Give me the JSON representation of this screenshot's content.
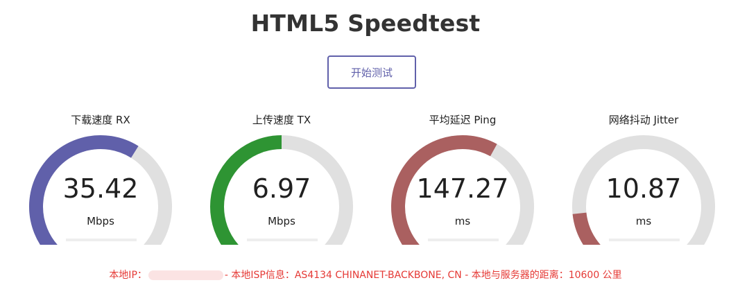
{
  "page": {
    "title": "HTML5 Speedtest",
    "start_button_label": "开始测试"
  },
  "gauges": [
    {
      "label": "下载速度 RX",
      "value": "35.42",
      "unit": "Mbps",
      "fill_fraction": 0.6,
      "color": "#6060AA"
    },
    {
      "label": "上传速度 TX",
      "value": "6.97",
      "unit": "Mbps",
      "fill_fraction": 0.5,
      "color": "#2E9433"
    },
    {
      "label": "平均延迟 Ping",
      "value": "147.27",
      "unit": "ms",
      "fill_fraction": 0.59,
      "color": "#AA6060"
    },
    {
      "label": "网络抖动 Jitter",
      "value": "10.87",
      "unit": "ms",
      "fill_fraction": 0.2,
      "color": "#AA6060"
    }
  ],
  "colors": {
    "track": "#E0E0E0",
    "footer_text": "#E53935",
    "accent": "#6060AA"
  },
  "footer": {
    "ip_label": "本地IP：",
    "isp_text": "- 本地ISP信息：AS4134 CHINANET-BACKBONE, CN - 本地与服务器的距离：10600 公里"
  }
}
